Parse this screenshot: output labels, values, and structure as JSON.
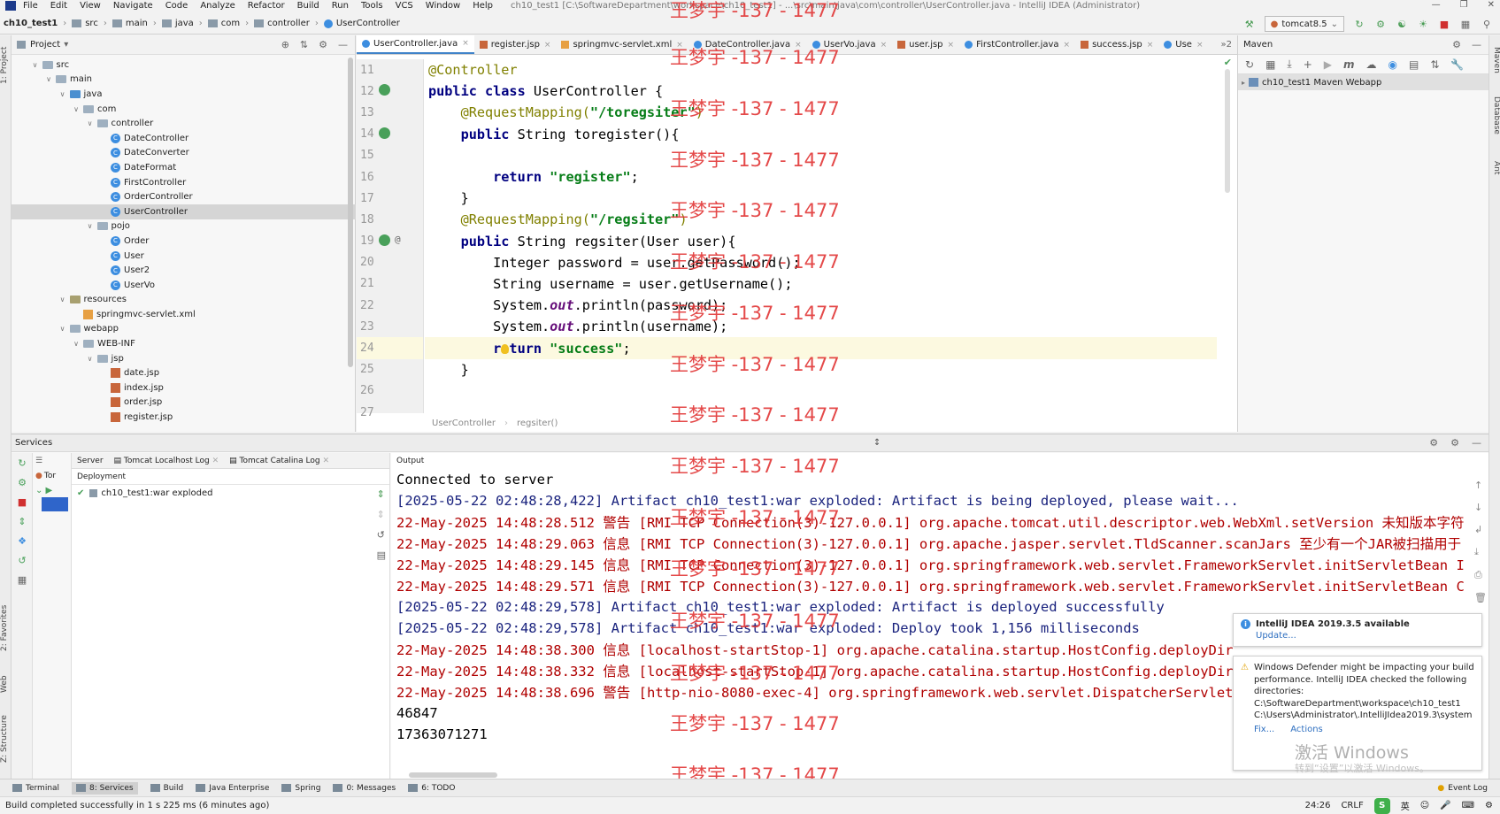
{
  "window": {
    "title": "ch10_test1 [C:\\SoftwareDepartment\\workspace\\ch10_test1] - ...\\src\\main\\java\\com\\controller\\UserController.java - IntelliJ IDEA (Administrator)"
  },
  "menu": [
    "File",
    "Edit",
    "View",
    "Navigate",
    "Code",
    "Analyze",
    "Refactor",
    "Build",
    "Run",
    "Tools",
    "VCS",
    "Window",
    "Help"
  ],
  "breadcrumbs": [
    "ch10_test1",
    "src",
    "main",
    "java",
    "com",
    "controller",
    "UserController"
  ],
  "run_config": "tomcat8.5",
  "project": {
    "title": "Project",
    "tree": [
      {
        "label": "src",
        "depth": 1,
        "kind": "folder",
        "open": true
      },
      {
        "label": "main",
        "depth": 2,
        "kind": "folder",
        "open": true
      },
      {
        "label": "java",
        "depth": 3,
        "kind": "folder",
        "open": true
      },
      {
        "label": "com",
        "depth": 4,
        "kind": "folder",
        "open": true
      },
      {
        "label": "controller",
        "depth": 5,
        "kind": "folder",
        "open": true
      },
      {
        "label": "DateController",
        "depth": 6,
        "kind": "class"
      },
      {
        "label": "DateConverter",
        "depth": 6,
        "kind": "class"
      },
      {
        "label": "DateFormat",
        "depth": 6,
        "kind": "class"
      },
      {
        "label": "FirstController",
        "depth": 6,
        "kind": "class"
      },
      {
        "label": "OrderController",
        "depth": 6,
        "kind": "class"
      },
      {
        "label": "UserController",
        "depth": 6,
        "kind": "class",
        "selected": true
      },
      {
        "label": "pojo",
        "depth": 5,
        "kind": "folder",
        "open": true
      },
      {
        "label": "Order",
        "depth": 6,
        "kind": "class"
      },
      {
        "label": "User",
        "depth": 6,
        "kind": "class"
      },
      {
        "label": "User2",
        "depth": 6,
        "kind": "class"
      },
      {
        "label": "UserVo",
        "depth": 6,
        "kind": "class"
      },
      {
        "label": "resources",
        "depth": 3,
        "kind": "folder",
        "open": true
      },
      {
        "label": "springmvc-servlet.xml",
        "depth": 4,
        "kind": "xml"
      },
      {
        "label": "webapp",
        "depth": 3,
        "kind": "folder",
        "open": true
      },
      {
        "label": "WEB-INF",
        "depth": 4,
        "kind": "folder",
        "open": true
      },
      {
        "label": "jsp",
        "depth": 5,
        "kind": "folder",
        "open": true
      },
      {
        "label": "date.jsp",
        "depth": 6,
        "kind": "jsp"
      },
      {
        "label": "index.jsp",
        "depth": 6,
        "kind": "jsp"
      },
      {
        "label": "order.jsp",
        "depth": 6,
        "kind": "jsp"
      },
      {
        "label": "register.jsp",
        "depth": 6,
        "kind": "jsp"
      }
    ]
  },
  "editor": {
    "tabs": [
      {
        "label": "UserController.java",
        "kind": "class",
        "active": true
      },
      {
        "label": "register.jsp",
        "kind": "jsp"
      },
      {
        "label": "springmvc-servlet.xml",
        "kind": "xml"
      },
      {
        "label": "DateController.java",
        "kind": "class"
      },
      {
        "label": "UserVo.java",
        "kind": "class"
      },
      {
        "label": "user.jsp",
        "kind": "jsp"
      },
      {
        "label": "FirstController.java",
        "kind": "class"
      },
      {
        "label": "success.jsp",
        "kind": "jsp"
      },
      {
        "label": "Use",
        "kind": "class"
      }
    ],
    "tab_overflow": "»2",
    "line_numbers": [
      "11",
      "12",
      "13",
      "14",
      "15",
      "16",
      "17",
      "18",
      "19",
      "20",
      "21",
      "22",
      "23",
      "24",
      "25",
      "26",
      "27"
    ],
    "current_line": "24",
    "code": [
      [
        {
          "t": "@Controller",
          "c": "ann"
        }
      ],
      [
        {
          "t": "public class ",
          "c": "kw"
        },
        {
          "t": "UserController {",
          "c": ""
        }
      ],
      [
        {
          "t": "    @RequestMapping(",
          "c": "ann"
        },
        {
          "t": "\"/toregsiter\"",
          "c": "str"
        },
        {
          "t": ")",
          "c": "ann"
        }
      ],
      [
        {
          "t": "    public ",
          "c": "kw"
        },
        {
          "t": "String toregister(){",
          "c": ""
        }
      ],
      [],
      [
        {
          "t": "        return ",
          "c": "kw"
        },
        {
          "t": "\"register\"",
          "c": "str"
        },
        {
          "t": ";",
          "c": ""
        }
      ],
      [
        {
          "t": "    }",
          "c": ""
        }
      ],
      [
        {
          "t": "    @RequestMapping(",
          "c": "ann"
        },
        {
          "t": "\"/regsiter\"",
          "c": "str"
        },
        {
          "t": ")",
          "c": "ann"
        }
      ],
      [
        {
          "t": "    public ",
          "c": "kw"
        },
        {
          "t": "String regsiter(User user){",
          "c": ""
        }
      ],
      [
        {
          "t": "        Integer password = user.getPassword();",
          "c": ""
        }
      ],
      [
        {
          "t": "        String username = user.getUsername();",
          "c": ""
        }
      ],
      [
        {
          "t": "        System.",
          "c": ""
        },
        {
          "t": "out",
          "c": "fld"
        },
        {
          "t": ".println(password);",
          "c": ""
        }
      ],
      [
        {
          "t": "        System.",
          "c": ""
        },
        {
          "t": "out",
          "c": "fld"
        },
        {
          "t": ".println(username);",
          "c": ""
        }
      ],
      [
        {
          "t": "        return ",
          "c": "kw"
        },
        {
          "t": "\"success\"",
          "c": "str"
        },
        {
          "t": ";",
          "c": ""
        }
      ],
      [
        {
          "t": "    }",
          "c": ""
        }
      ],
      [],
      []
    ],
    "breadcrumb": [
      "UserController",
      "regsiter()"
    ]
  },
  "maven": {
    "title": "Maven",
    "item": "ch10_test1 Maven Webapp"
  },
  "services": {
    "title": "Services",
    "server_tabs": [
      "Server",
      "Tomcat Localhost Log",
      "Tomcat Catalina Log"
    ],
    "tree_item": "Tor",
    "deployment_header": "Deployment",
    "deployment_item": "ch10_test1:war exploded",
    "output_header": "Output",
    "output": [
      {
        "text": "Connected to server",
        "c": "k"
      },
      {
        "text": "[2025-05-22 02:48:28,422] Artifact ch10_test1:war exploded: Artifact is being deployed, please wait...",
        "c": "b"
      },
      {
        "text": "22-May-2025 14:48:28.512 警告 [RMI TCP Connection(3)-127.0.0.1] org.apache.tomcat.util.descriptor.web.WebXml.setVersion 未知版本字符",
        "c": "r"
      },
      {
        "text": "22-May-2025 14:48:29.063 信息 [RMI TCP Connection(3)-127.0.0.1] org.apache.jasper.servlet.TldScanner.scanJars 至少有一个JAR被扫描用于",
        "c": "r"
      },
      {
        "text": "22-May-2025 14:48:29.145 信息 [RMI TCP Connection(3)-127.0.0.1] org.springframework.web.servlet.FrameworkServlet.initServletBean I",
        "c": "r"
      },
      {
        "text": "22-May-2025 14:48:29.571 信息 [RMI TCP Connection(3)-127.0.0.1] org.springframework.web.servlet.FrameworkServlet.initServletBean C",
        "c": "r"
      },
      {
        "text": "[2025-05-22 02:48:29,578] Artifact ch10_test1:war exploded: Artifact is deployed successfully",
        "c": "b"
      },
      {
        "text": "[2025-05-22 02:48:29,578] Artifact ch10_test1:war exploded: Deploy took 1,156 milliseconds",
        "c": "b"
      },
      {
        "text": "22-May-2025 14:48:38.300 信息 [localhost-startStop-1] org.apache.catalina.startup.HostConfig.deployDir",
        "c": "r"
      },
      {
        "text": "22-May-2025 14:48:38.332 信息 [localhost-startStop-1] org.apache.catalina.startup.HostConfig.deployDir",
        "c": "r"
      },
      {
        "text": "22-May-2025 14:48:38.696 警告 [http-nio-8080-exec-4] org.springframework.web.servlet.DispatcherServlet",
        "c": "r"
      },
      {
        "text": "46847",
        "c": "k"
      },
      {
        "text": "17363071271",
        "c": "k"
      }
    ]
  },
  "notifications": {
    "update_title": "IntelliJ IDEA 2019.3.5 available",
    "update_link": "Update...",
    "defender_text": "Windows Defender might be impacting your build performance. IntelliJ IDEA checked the following directories:",
    "defender_dir1": "C:\\SoftwareDepartment\\workspace\\ch10_test1",
    "defender_dir2": "C:\\Users\\Administrator\\.IntelliJIdea2019.3\\system",
    "fix": "Fix...",
    "actions": "Actions",
    "activate": "激活 Windows",
    "activate_sub": "转到“设置”以激活 Windows。"
  },
  "watermark": "王梦宇 -137 - 1477",
  "bottom_tools": [
    {
      "label": "Terminal"
    },
    {
      "label": "8: Services",
      "active": true
    },
    {
      "label": "Build"
    },
    {
      "label": "Java Enterprise"
    },
    {
      "label": "Spring"
    },
    {
      "label": "0: Messages"
    },
    {
      "label": "6: TODO"
    }
  ],
  "event_log": "Event Log",
  "status": {
    "message": "Build completed successfully in 1 s 225 ms (6 minutes ago)",
    "position": "24:26",
    "line_sep": "CRLF",
    "ime": "S",
    "ime_lang": "英"
  },
  "left_strip_labels": [
    "1: Project",
    "2: Favorites",
    "Web",
    "Z: Structure"
  ],
  "right_strip_labels": [
    "Maven",
    "Database",
    "Ant"
  ]
}
